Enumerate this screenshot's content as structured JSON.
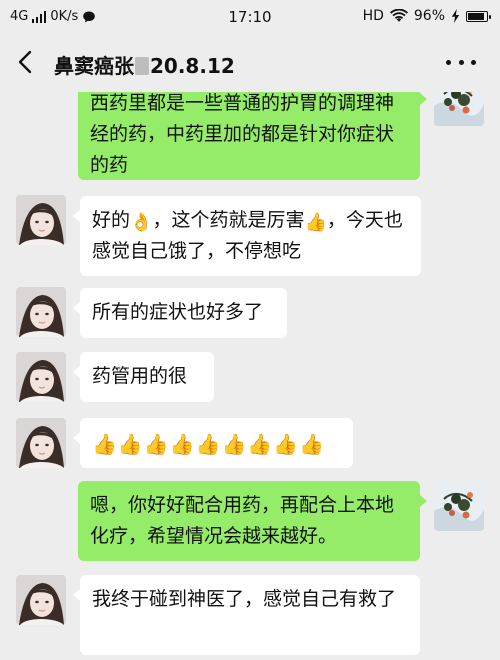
{
  "status_bar": {
    "network": "4G",
    "speed": "0K/s",
    "time": "17:10",
    "hd": "HD",
    "battery": "96%",
    "battery_fraction": 0.96
  },
  "header": {
    "title_prefix": "鼻窦癌张",
    "title_suffix": "20.8.12"
  },
  "messages": [
    {
      "side": "right",
      "text": "西药里都是一些普通的护胃的调理神经的药，中药里加的都是针对你症状的药"
    },
    {
      "side": "left",
      "parts": [
        "好的",
        "👌",
        "，这个药就是厉害",
        "👍",
        "，今天也感觉自己饿了，不停想吃"
      ]
    },
    {
      "side": "left",
      "text": "所有的症状也好多了"
    },
    {
      "side": "left",
      "text": "药管用的很"
    },
    {
      "side": "left",
      "text": "👍👍👍👍👍👍👍👍👍"
    },
    {
      "side": "right",
      "text": "嗯，你好好配合用药，再配合上本地化疗，希望情况会越来越好。"
    },
    {
      "side": "left",
      "text": "我终于碰到神医了，感觉自己有救了"
    }
  ],
  "colors": {
    "background": "#ededed",
    "sent_bubble": "#95ec69",
    "received_bubble": "#ffffff"
  }
}
